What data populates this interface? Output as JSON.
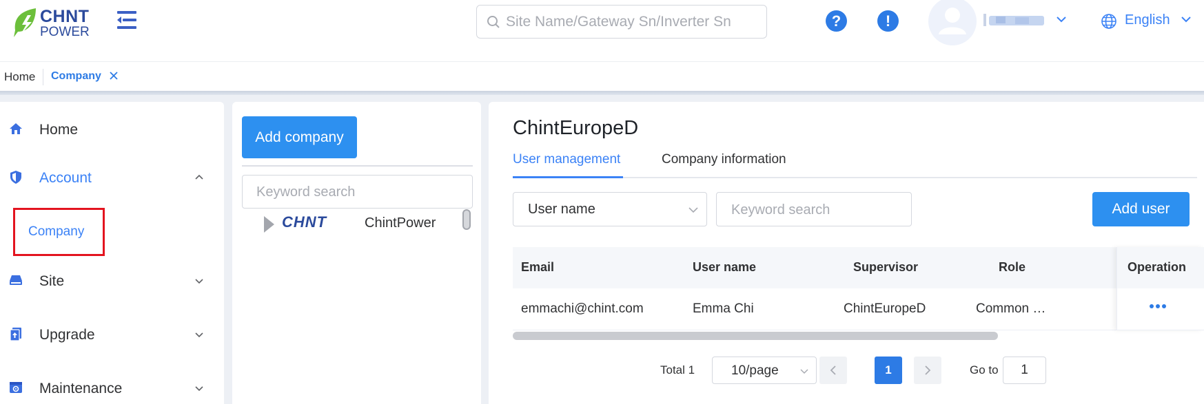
{
  "header": {
    "logo_line1": "CHNT",
    "logo_line2": "POWER",
    "search_placeholder": "Site Name/Gateway Sn/Inverter Sn",
    "help_glyph": "?",
    "alert_glyph": "!",
    "language": "English"
  },
  "breadcrumb": {
    "home": "Home",
    "current": "Company"
  },
  "sidebar": {
    "items": [
      {
        "label": "Home",
        "icon": "home-icon"
      },
      {
        "label": "Account",
        "icon": "shield-icon",
        "expanded": true
      },
      {
        "label": "Site",
        "icon": "site-icon"
      },
      {
        "label": "Upgrade",
        "icon": "upgrade-icon"
      },
      {
        "label": "Maintenance",
        "icon": "maintenance-icon"
      }
    ],
    "sub_item": "Company"
  },
  "tree": {
    "add_button": "Add company",
    "search_placeholder": "Keyword search",
    "node_logo": "CHNT",
    "node_label": "ChintPower"
  },
  "main": {
    "title": "ChintEuropeD",
    "tabs": [
      "User management",
      "Company information"
    ],
    "filter_select": "User name",
    "keyword_placeholder": "Keyword search",
    "add_user_button": "Add user",
    "table": {
      "columns": [
        "Email",
        "User name",
        "Supervisor",
        "Role",
        "Operation"
      ],
      "rows": [
        {
          "email": "emmachi@chint.com",
          "user_name": "Emma Chi",
          "supervisor": "ChintEuropeD",
          "role": "Common …"
        }
      ]
    },
    "pagination": {
      "total": "Total 1",
      "page_size": "10/page",
      "current_page": "1",
      "goto_label": "Go to",
      "goto_value": "1"
    }
  },
  "colors": {
    "accent": "#2d7be5",
    "primary_button": "#2d90f0",
    "highlight_box": "#e3141f",
    "brand": "#2b4a9c"
  }
}
